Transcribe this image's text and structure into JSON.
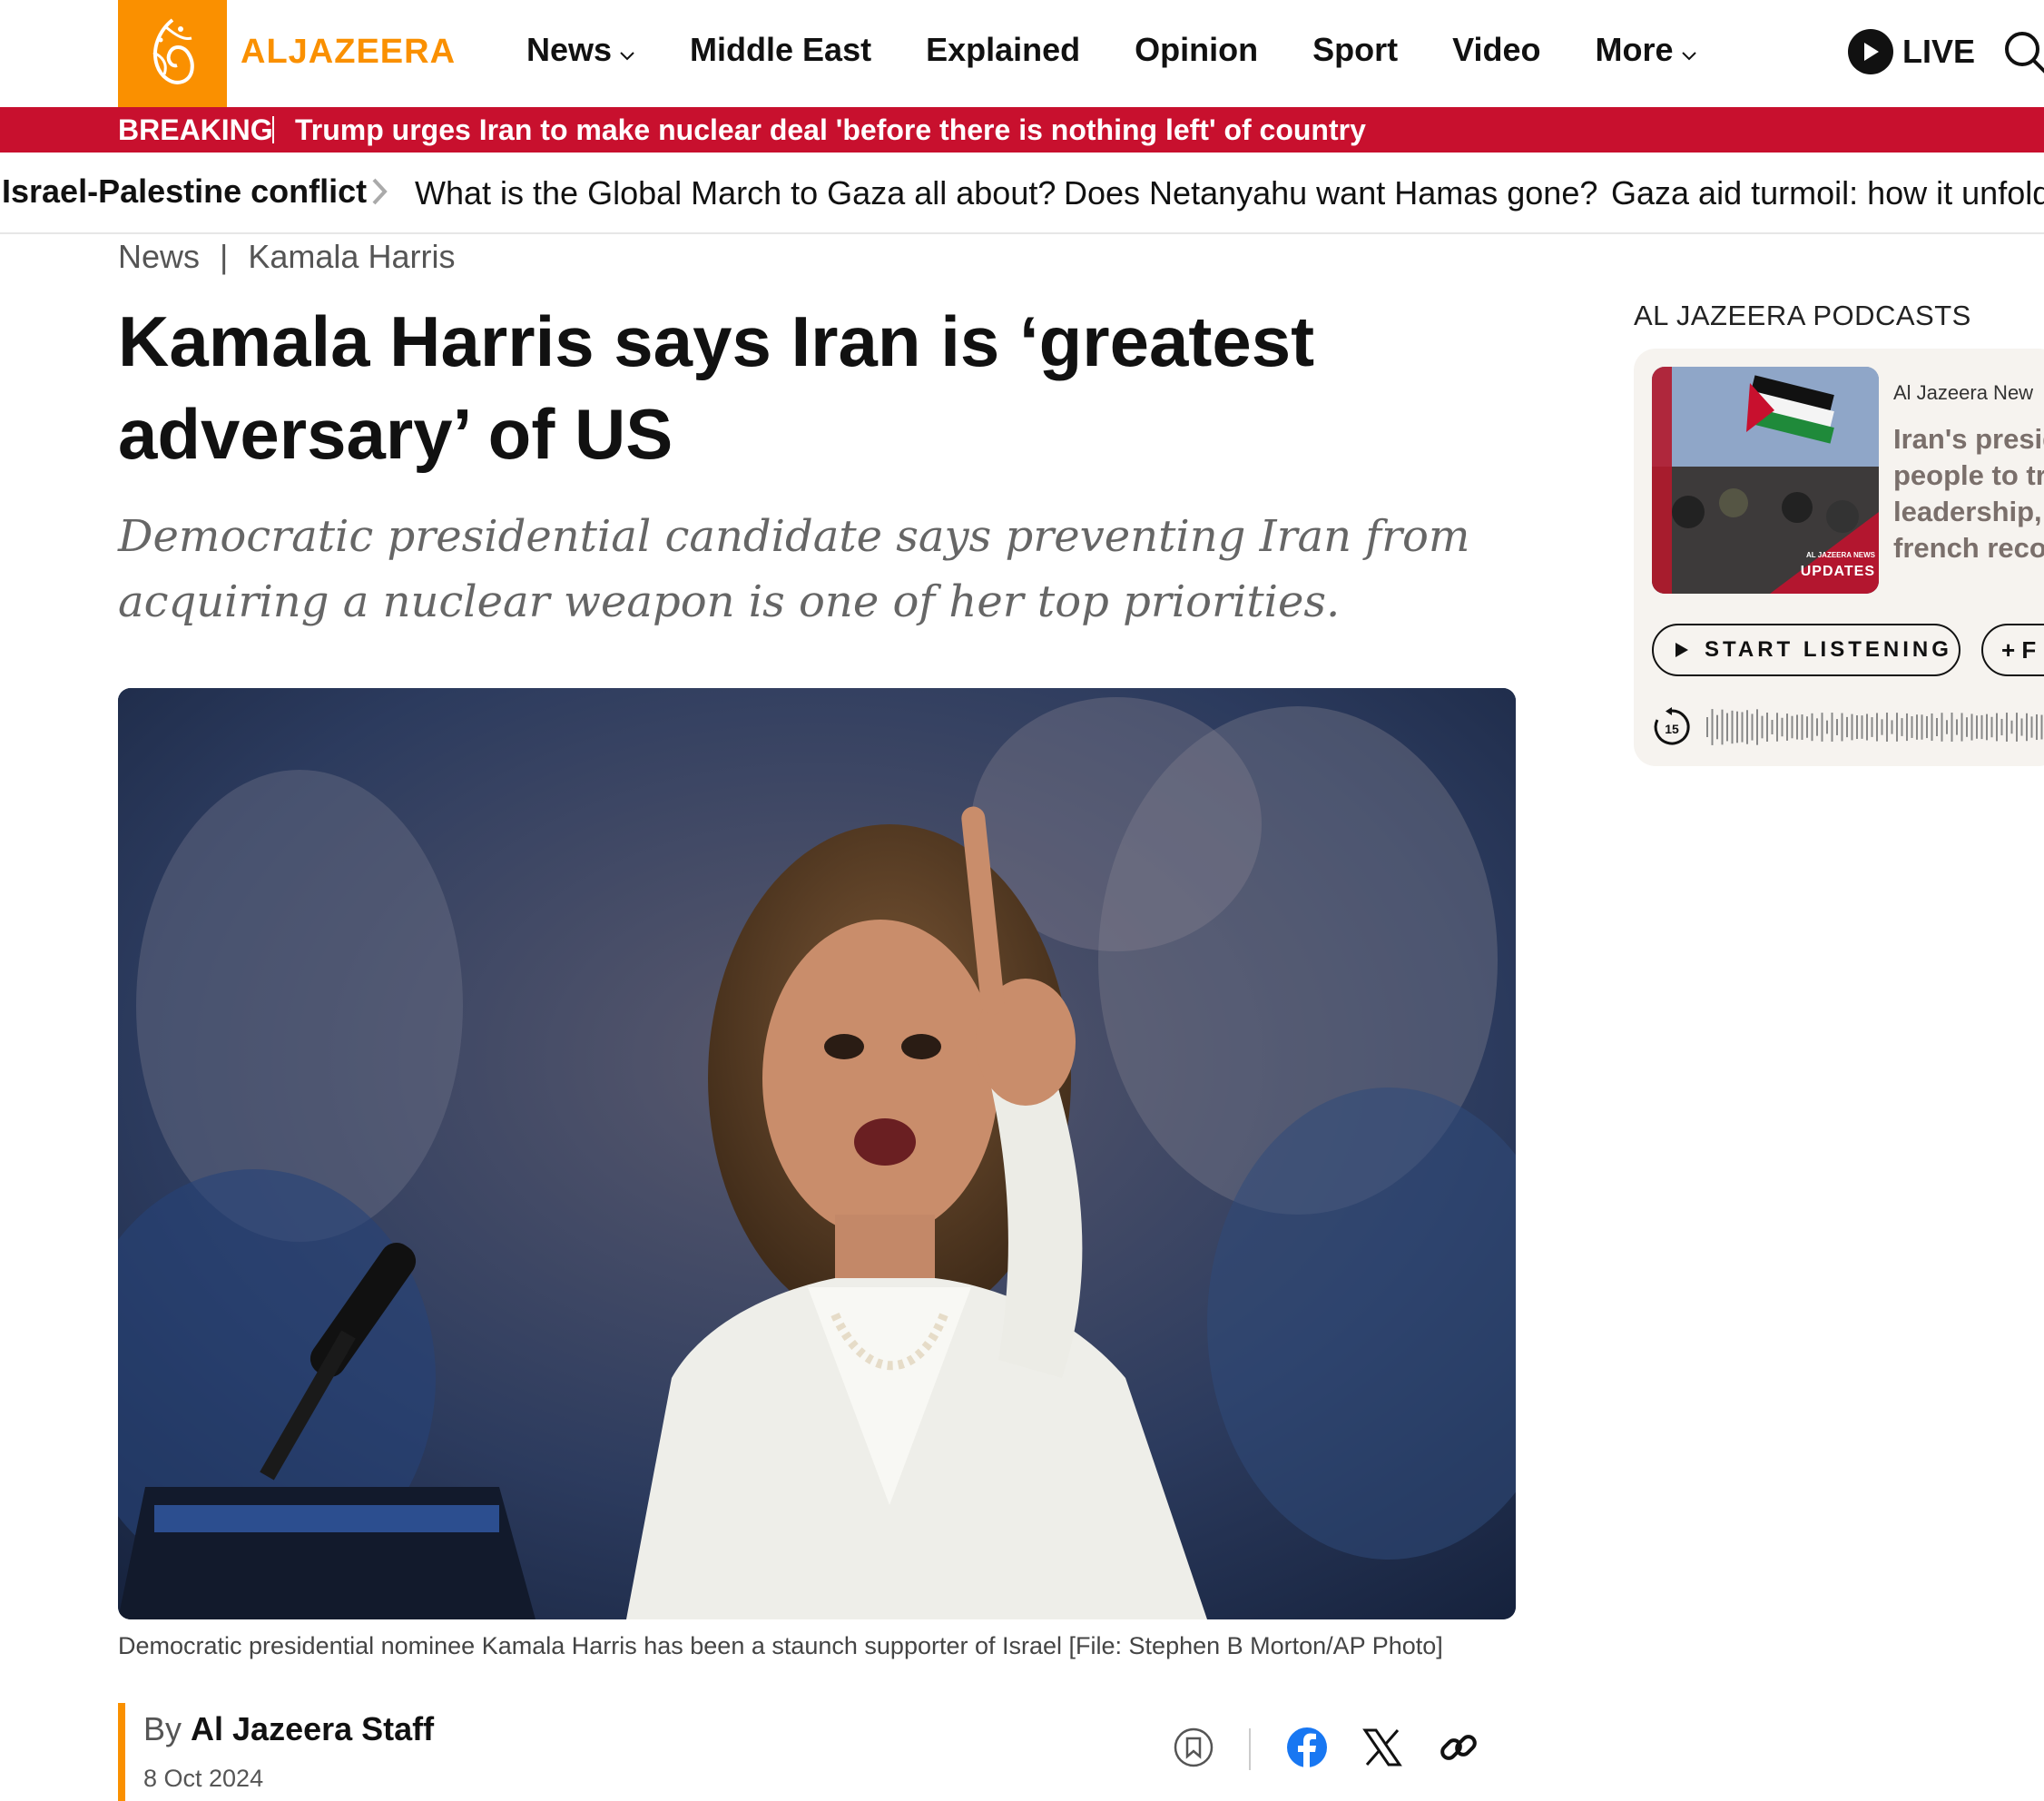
{
  "header": {
    "brand": "ALJAZEERA",
    "nav": [
      {
        "label": "News",
        "dropdown": true
      },
      {
        "label": "Middle East",
        "dropdown": false
      },
      {
        "label": "Explained",
        "dropdown": false
      },
      {
        "label": "Opinion",
        "dropdown": false
      },
      {
        "label": "Sport",
        "dropdown": false
      },
      {
        "label": "Video",
        "dropdown": false
      },
      {
        "label": "More",
        "dropdown": true
      }
    ],
    "live_label": "LIVE",
    "brand_color": "#fa9000"
  },
  "breaking": {
    "label": "BREAKING",
    "text": "Trump urges Iran to make nuclear deal 'before there is nothing left' of country",
    "color": "#c8102e"
  },
  "topics": {
    "main": "Israel-Palestine conflict",
    "links": [
      "What is the Global March to Gaza all about?",
      "Does Netanyahu want Hamas gone?",
      "Gaza aid turmoil: how it unfold"
    ]
  },
  "article": {
    "breadcrumb": [
      "News",
      "Kamala Harris"
    ],
    "headline_line1": "Kamala Harris says Iran is ‘greatest",
    "headline_line2": "adversary’ of US",
    "subhead_line1": "Democratic presidential candidate says preventing Iran from",
    "subhead_line2": "acquiring a nuclear weapon is one of her top priorities.",
    "caption": "Democratic presidential nominee Kamala Harris has been a staunch supporter of Israel [File: Stephen B Morton/AP Photo]",
    "byline_prefix": "By",
    "author": "Al Jazeera Staff",
    "date": "8 Oct 2024"
  },
  "share_icons": [
    "bookmark-icon",
    "facebook-icon",
    "x-icon",
    "link-icon"
  ],
  "sidebar": {
    "title": "AL JAZEERA PODCASTS",
    "podcast": {
      "source": "Al Jazeera New",
      "title_lines": [
        "Iran's presid",
        "people to tr",
        "leadership,",
        "french reco"
      ],
      "thumb_badge_top": "AL JAZEERA NEWS",
      "thumb_badge": "UPDATES",
      "listen_label": "START LISTENING",
      "plus_label": "+ F",
      "skip_label": "15"
    }
  }
}
